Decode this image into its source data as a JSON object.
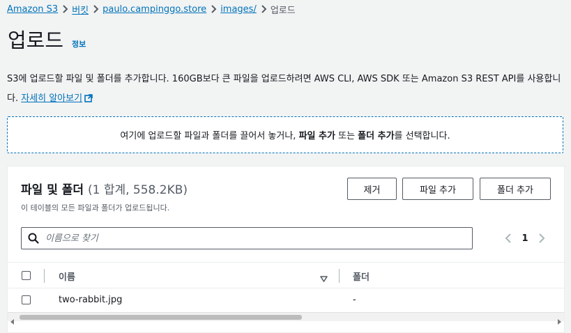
{
  "breadcrumb": {
    "items": [
      "Amazon S3",
      "버킷",
      "paulo.campinggo.store",
      "images/"
    ],
    "current": "업로드"
  },
  "header": {
    "title": "업로드",
    "info": "정보"
  },
  "description": {
    "text": "S3에 업로드할 파일 및 폴더를 추가합니다. 160GB보다 큰 파일을 업로드하려면 AWS CLI, AWS SDK 또는 Amazon S3 REST API를 사용합니다.",
    "learn_more": "자세히 알아보기"
  },
  "dropzone": {
    "prefix": "여기에 업로드할 파일과 폴더를 끌어서 놓거나,",
    "add_files": "파일 추가",
    "middle": "또는",
    "add_folder": "폴더 추가",
    "suffix": "를 선택합니다."
  },
  "panel": {
    "title": "파일 및 폴더",
    "count": "(1 합계, 558.2KB)",
    "subtitle": "이 테이블의 모든 파일과 폴더가 업로드됩니다.",
    "buttons": {
      "remove": "제거",
      "add_files": "파일 추가",
      "add_folder": "폴더 추가"
    },
    "search": {
      "placeholder": "이름으로 찾기",
      "value": ""
    },
    "pagination": {
      "page": "1"
    },
    "columns": {
      "name": "이름",
      "folder": "폴더"
    },
    "rows": [
      {
        "name": "two-rabbit.jpg",
        "folder": "-"
      }
    ],
    "scroll_fraction": 0.53
  },
  "icons": {
    "breadcrumb_separator": "chevron-right-icon",
    "external_link": "external-link-icon",
    "search": "search-icon",
    "sort": "sort-down-icon"
  },
  "colors": {
    "link": "#0073bb",
    "text": "#16191f",
    "muted": "#545b64",
    "background": "#f2f3f3"
  }
}
